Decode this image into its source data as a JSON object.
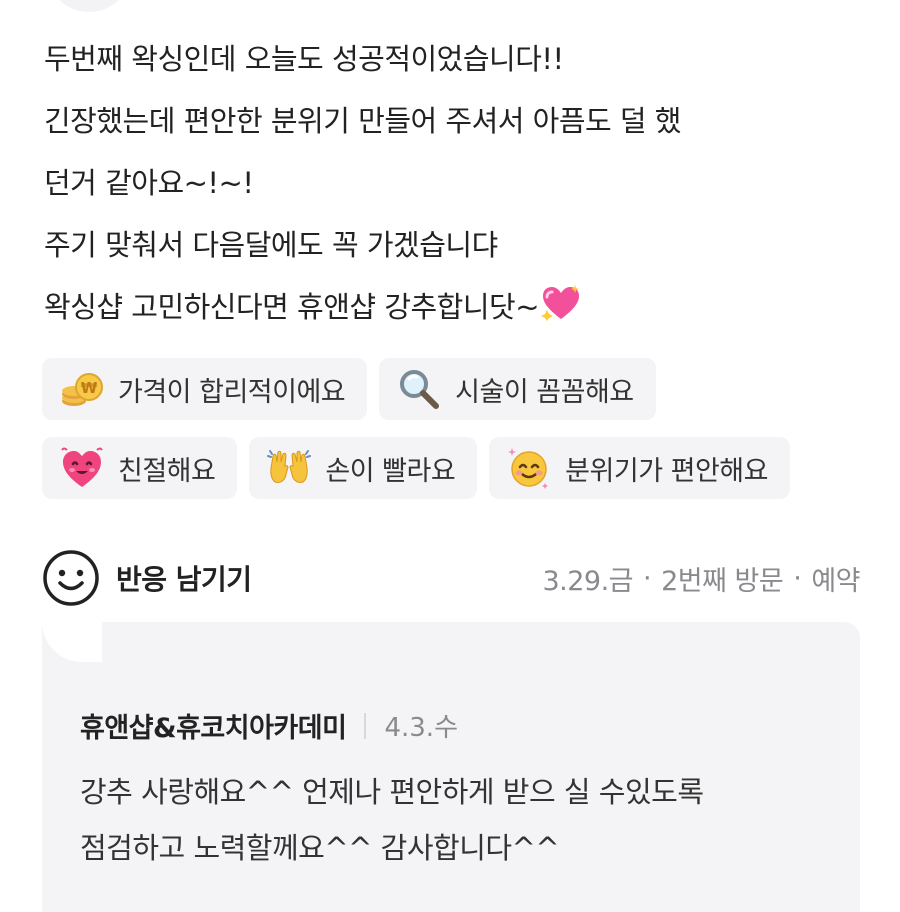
{
  "review": {
    "lines": [
      "두번째 왁싱인데 오늘도 성공적이었습니다!!",
      "긴장했는데 편안한 분위기 만들어 주셔서 아픔도 덜 했",
      "던거 같아요~!~!",
      "주기 맞춰서 다음달에도 꼭 가겠습니댜",
      "왁싱샵 고민하신다면 휴앤샵 강추합니닷~"
    ],
    "trailing_emoji": "sparkling-heart-icon"
  },
  "keywords": [
    [
      {
        "icon": "coins-won-icon",
        "label": "가격이 합리적이에요"
      },
      {
        "icon": "magnifying-glass-icon",
        "label": "시술이 꼼꼼해요"
      }
    ],
    [
      {
        "icon": "heart-face-icon",
        "label": "친절해요"
      },
      {
        "icon": "raised-hands-icon",
        "label": "손이 빨라요"
      },
      {
        "icon": "smiling-face-icon",
        "label": "분위기가 편안해요"
      }
    ]
  ],
  "reaction": {
    "label": "반응 남기기",
    "icon": "smile-outline-icon"
  },
  "visit_meta": {
    "date": "3.29.금",
    "visit_count": "2번째 방문",
    "type": "예약",
    "separator": "·"
  },
  "owner_reply": {
    "shop_name": "휴앤샵&휴코치아카데미",
    "date": "4.3.수",
    "lines": [
      "강추 사랑해요^^ 언제나 편안하게 받으 실 수있도록",
      "점검하고 노력할께요^^ 감사합니다^^"
    ]
  },
  "colors": {
    "text_primary": "#222222",
    "text_secondary": "#8a8a8e",
    "chip_background": "#f4f4f6",
    "reply_background": "#f4f4f6"
  }
}
